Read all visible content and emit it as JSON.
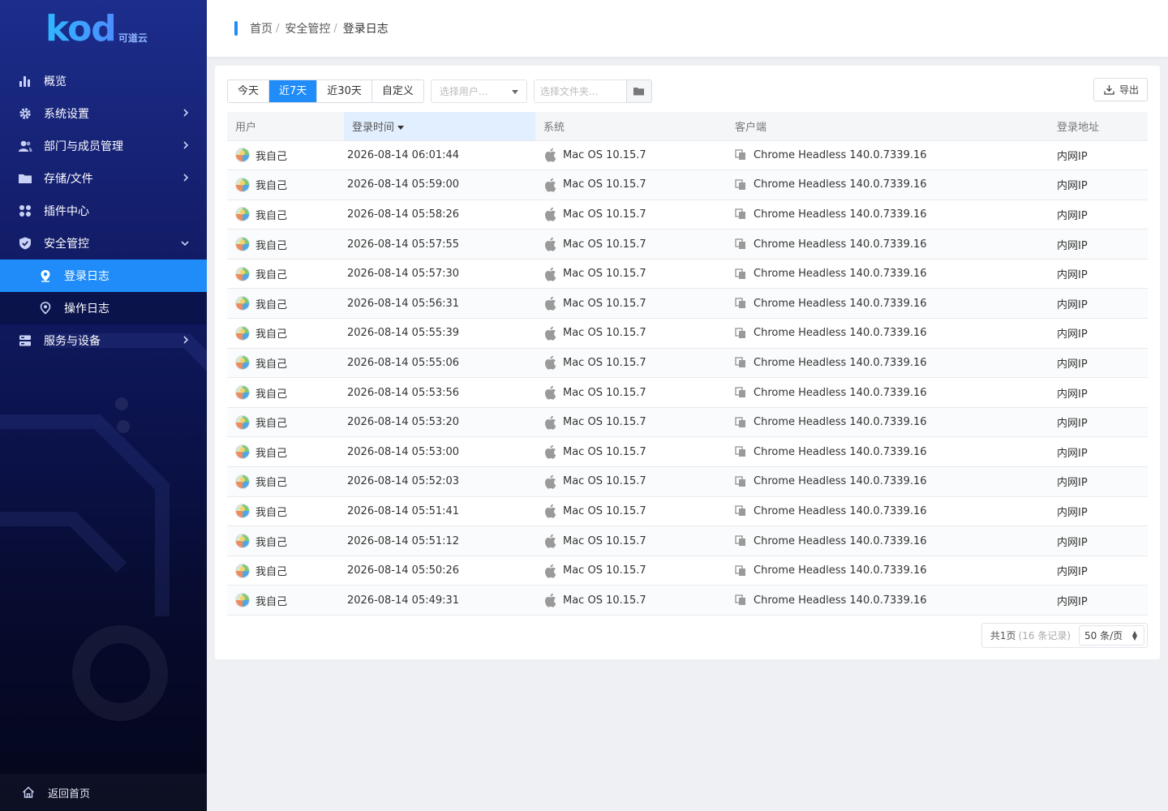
{
  "sidebar": {
    "logo_text": "kod",
    "logo_sub": "可道云",
    "menu": [
      {
        "label": "概览",
        "icon": "bar-chart-icon"
      },
      {
        "label": "系统设置",
        "icon": "gear-icon"
      },
      {
        "label": "部门与成员管理",
        "icon": "users-icon"
      },
      {
        "label": "存储/文件",
        "icon": "folder-icon"
      },
      {
        "label": "插件中心",
        "icon": "grid-icon"
      },
      {
        "label": "安全管控",
        "icon": "shield-icon"
      }
    ],
    "submenu": [
      {
        "label": "登录日志",
        "icon": "location-pin-icon"
      },
      {
        "label": "操作日志",
        "icon": "location-pin-icon"
      }
    ],
    "menu_after": {
      "label": "服务与设备",
      "icon": "server-icon"
    },
    "back_home": "返回首页"
  },
  "breadcrumb": {
    "items": [
      "首页",
      "安全管控",
      "登录日志"
    ],
    "sep": "/"
  },
  "toolbar": {
    "ranges": [
      "今天",
      "近7天",
      "近30天",
      "自定义"
    ],
    "active_range": "近7天",
    "user_placeholder": "选择用户...",
    "folder_placeholder": "选择文件夹...",
    "export_label": "导出"
  },
  "table": {
    "headers": [
      "用户",
      "登录时间",
      "系统",
      "客户端",
      "登录地址"
    ],
    "sorted_column": "登录时间",
    "rows": [
      {
        "user": "我自己",
        "time": "2026-08-14 06:01:44",
        "system": "Mac OS 10.15.7",
        "client": "Chrome Headless 140.0.7339.16",
        "address": "内网IP"
      },
      {
        "user": "我自己",
        "time": "2026-08-14 05:59:00",
        "system": "Mac OS 10.15.7",
        "client": "Chrome Headless 140.0.7339.16",
        "address": "内网IP"
      },
      {
        "user": "我自己",
        "time": "2026-08-14 05:58:26",
        "system": "Mac OS 10.15.7",
        "client": "Chrome Headless 140.0.7339.16",
        "address": "内网IP"
      },
      {
        "user": "我自己",
        "time": "2026-08-14 05:57:55",
        "system": "Mac OS 10.15.7",
        "client": "Chrome Headless 140.0.7339.16",
        "address": "内网IP"
      },
      {
        "user": "我自己",
        "time": "2026-08-14 05:57:30",
        "system": "Mac OS 10.15.7",
        "client": "Chrome Headless 140.0.7339.16",
        "address": "内网IP"
      },
      {
        "user": "我自己",
        "time": "2026-08-14 05:56:31",
        "system": "Mac OS 10.15.7",
        "client": "Chrome Headless 140.0.7339.16",
        "address": "内网IP"
      },
      {
        "user": "我自己",
        "time": "2026-08-14 05:55:39",
        "system": "Mac OS 10.15.7",
        "client": "Chrome Headless 140.0.7339.16",
        "address": "内网IP"
      },
      {
        "user": "我自己",
        "time": "2026-08-14 05:55:06",
        "system": "Mac OS 10.15.7",
        "client": "Chrome Headless 140.0.7339.16",
        "address": "内网IP"
      },
      {
        "user": "我自己",
        "time": "2026-08-14 05:53:56",
        "system": "Mac OS 10.15.7",
        "client": "Chrome Headless 140.0.7339.16",
        "address": "内网IP"
      },
      {
        "user": "我自己",
        "time": "2026-08-14 05:53:20",
        "system": "Mac OS 10.15.7",
        "client": "Chrome Headless 140.0.7339.16",
        "address": "内网IP"
      },
      {
        "user": "我自己",
        "time": "2026-08-14 05:53:00",
        "system": "Mac OS 10.15.7",
        "client": "Chrome Headless 140.0.7339.16",
        "address": "内网IP"
      },
      {
        "user": "我自己",
        "time": "2026-08-14 05:52:03",
        "system": "Mac OS 10.15.7",
        "client": "Chrome Headless 140.0.7339.16",
        "address": "内网IP"
      },
      {
        "user": "我自己",
        "time": "2026-08-14 05:51:41",
        "system": "Mac OS 10.15.7",
        "client": "Chrome Headless 140.0.7339.16",
        "address": "内网IP"
      },
      {
        "user": "我自己",
        "time": "2026-08-14 05:51:12",
        "system": "Mac OS 10.15.7",
        "client": "Chrome Headless 140.0.7339.16",
        "address": "内网IP"
      },
      {
        "user": "我自己",
        "time": "2026-08-14 05:50:26",
        "system": "Mac OS 10.15.7",
        "client": "Chrome Headless 140.0.7339.16",
        "address": "内网IP"
      },
      {
        "user": "我自己",
        "time": "2026-08-14 05:49:31",
        "system": "Mac OS 10.15.7",
        "client": "Chrome Headless 140.0.7339.16",
        "address": "内网IP"
      }
    ]
  },
  "pager": {
    "pages": "共1页",
    "records": "(16 条记录)",
    "per_page": "50 条/页"
  },
  "colors": {
    "accent": "#1f8cf9",
    "sidebar_top": "#1c2d8c",
    "sidebar_bottom": "#04061a"
  }
}
